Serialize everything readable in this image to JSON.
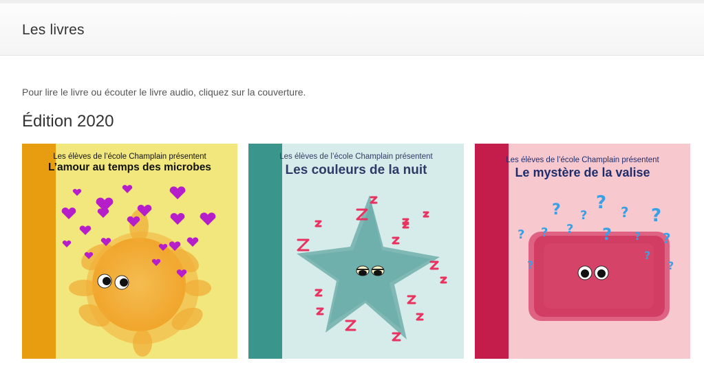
{
  "header": {
    "title": "Les livres"
  },
  "main": {
    "intro": "Pour lire le livre ou écouter le livre audio, cliquez sur la couverture.",
    "edition_heading": "Édition 2020",
    "books": [
      {
        "presenter": "Les élèves de l’école Champlain présentent",
        "title": "L’amour au temps des microbes",
        "spine_color": "#e89c10",
        "cover_color": "#f1e77d",
        "title_color": "#111111",
        "art_icon": "sun-with-hearts"
      },
      {
        "presenter": "Les élèves de l’école Champlain présentent",
        "title": "Les couleurs de la nuit",
        "spine_color": "#3a958c",
        "cover_color": "#d6ecea",
        "title_color": "#2e3b66",
        "art_icon": "sleeping-star"
      },
      {
        "presenter": "Les élèves de l’école Champlain présentent",
        "title": "Le mystère de la valise",
        "spine_color": "#c41d4c",
        "cover_color": "#f8c8cf",
        "title_color": "#1e2d6b",
        "art_icon": "suitcase-with-question-marks"
      }
    ]
  }
}
